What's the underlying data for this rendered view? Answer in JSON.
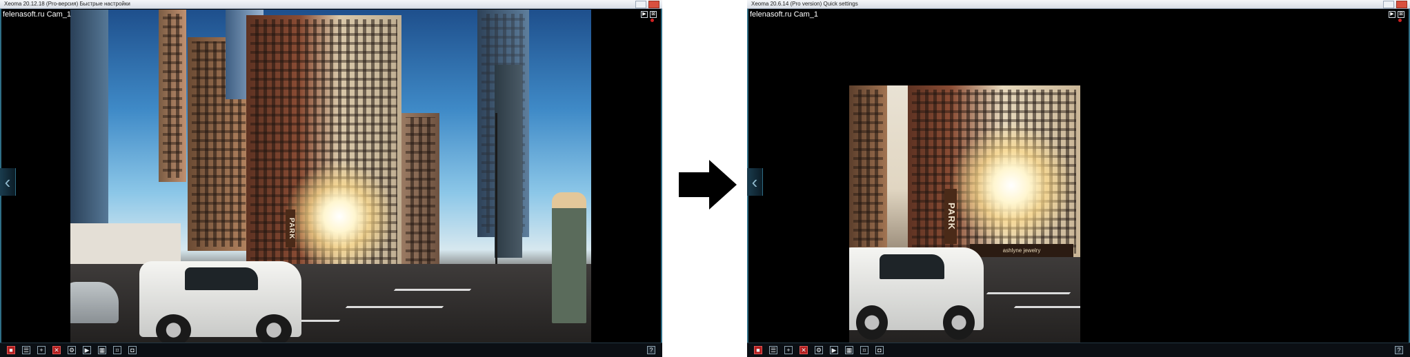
{
  "left_window": {
    "title": "Xeoma 20.12.18 (Pro-версия) Быстрые настройки",
    "camera_title": "felenasoft.ru Cam_1",
    "help_label": "?"
  },
  "right_window": {
    "title": "Xeoma 20.6.14 (Pro version) Quick settings",
    "camera_title": "felenasoft.ru Cam_1",
    "help_label": "?"
  },
  "photo": {
    "park_sign": "PARK",
    "shop_sign": "ashlyne jewelry"
  },
  "toolbar_icons": [
    "stop-icon",
    "list-icon",
    "plus-icon",
    "delete-icon",
    "settings-icon",
    "play-icon",
    "archive-icon",
    "crop-icon",
    "screenshot-icon"
  ],
  "colors": {
    "frame": "#2f6e86",
    "record_dot": "#d02020",
    "arrow": "#000000"
  }
}
